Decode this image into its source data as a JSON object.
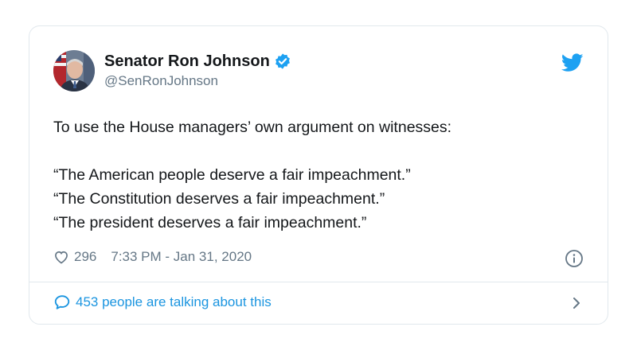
{
  "tweet": {
    "author": {
      "display_name": "Senator Ron Johnson",
      "handle": "@SenRonJohnson"
    },
    "text_lines": [
      "To use the House managers’ own argument on witnesses:",
      "“The American people deserve a fair impeachment.”",
      "“The Constitution deserves a fair impeachment.”",
      "“The president deserves a fair impeachment.”"
    ],
    "likes": "296",
    "timestamp": "7:33 PM - Jan 31, 2020",
    "footer_text": "453 people are talking about this"
  },
  "icons": {
    "verified": "verified-badge-icon",
    "bird": "twitter-bird-icon",
    "like": "heart-icon",
    "info": "info-icon",
    "reply": "speech-bubble-icon",
    "more": "chevron-right-icon"
  },
  "colors": {
    "brand": "#1da1f2",
    "link": "#1b95e0",
    "text": "#14171a",
    "secondary": "#657786",
    "border": "#e1e8ed"
  }
}
